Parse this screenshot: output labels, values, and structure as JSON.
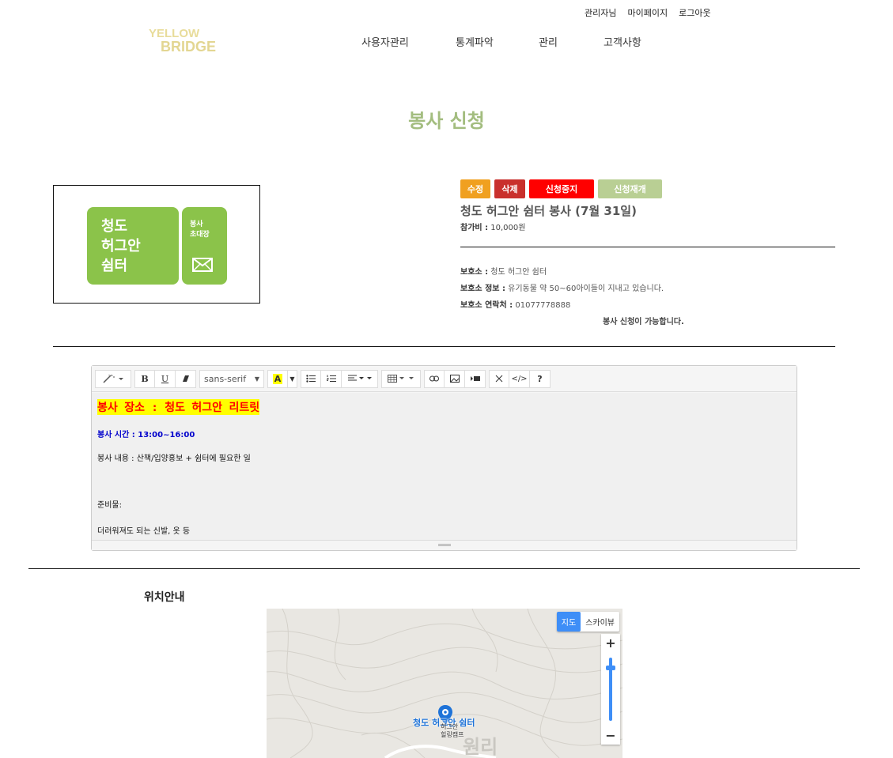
{
  "header": {
    "user_name": "관리자님",
    "mypage": "마이페이지",
    "logout": "로그아웃",
    "logo_line1": "YELLOW",
    "logo_line2": "BRIDGE",
    "nav": [
      "사용자관리",
      "통계파악",
      "관리",
      "고객사항"
    ]
  },
  "page_title": "봉사 신청",
  "ticket": {
    "title_line1": "청도",
    "title_line2": "허그안",
    "title_line3": "쉼터",
    "sub_line1": "봉사",
    "sub_line2": "초대장",
    "color": "#8bc34a",
    "icon": "envelope-icon"
  },
  "buttons": {
    "edit": "수정",
    "delete": "삭제",
    "stop": "신청중지",
    "restart": "신청재개"
  },
  "info": {
    "title": "청도 허그안 쉼터 봉사 (7월 31일)",
    "fee_label": "참가비 :",
    "fee_value": "10,000원",
    "shelter_label": "보호소 :",
    "shelter_value": "청도 허그안 쉼터",
    "shelter_info_label": "보호소 정보 :",
    "shelter_info_value": "유기동물 약 50~60아이들이 지내고 있습니다.",
    "contact_label": "보호소 연락처 :",
    "contact_value": "01077778888",
    "availability": "봉사 신청이 가능합니다."
  },
  "editor": {
    "font_name": "sans-serif",
    "place": "봉사 장소 : 청도 허그안 리트릿",
    "time": "봉사 시간 : 13:00~16:00",
    "description": "봉사 내용 : 산책/입양홍보 + 쉼터에 필요한 일",
    "prep_label": "준비물:",
    "prep_items": "더러워져도 되는 신발, 옷 등"
  },
  "location": {
    "title": "위치안내",
    "map_type_map": "지도",
    "map_type_sky": "스카이뷰",
    "marker_label": "청도 허그안 쉼터",
    "marker_sub1": "허그안",
    "marker_sub2": "힐링캠프",
    "area_label": "원리"
  },
  "colors": {
    "title_green": "#a3bd7f",
    "edit": "#f0a020",
    "delete": "#c9302c",
    "stop": "#ff0000",
    "restart": "#b9cf94",
    "map_accent": "#3e8ef7"
  }
}
